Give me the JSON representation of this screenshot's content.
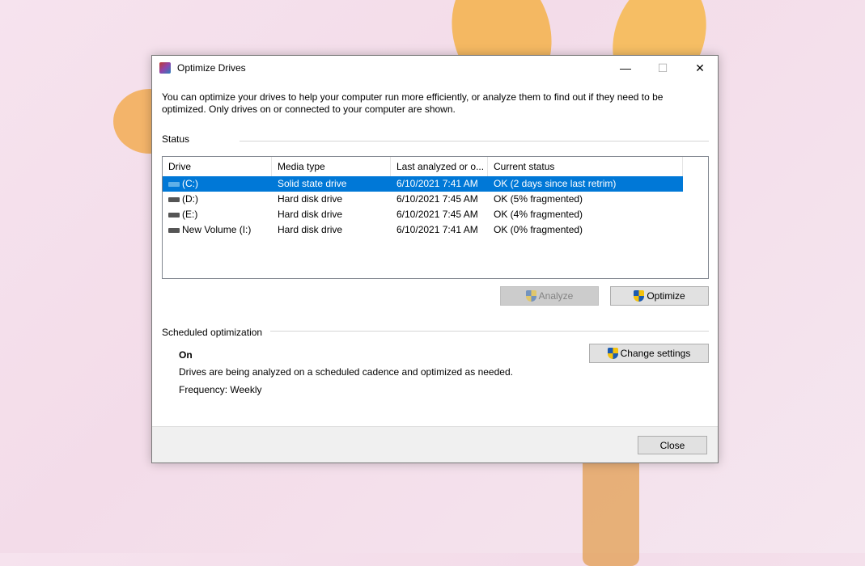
{
  "window": {
    "title": "Optimize Drives",
    "minimize": "—",
    "maximize": "☐",
    "close": "✕"
  },
  "description": "You can optimize your drives to help your computer run more efficiently, or analyze them to find out if they need to be optimized. Only drives on or connected to your computer are shown.",
  "status": {
    "label": "Status",
    "columns": [
      "Drive",
      "Media type",
      "Last analyzed or o...",
      "Current status"
    ],
    "rows": [
      {
        "drive": "(C:)",
        "media": "Solid state drive",
        "last": "6/10/2021 7:41 AM",
        "status": "OK (2 days since last retrim)",
        "selected": true
      },
      {
        "drive": "(D:)",
        "media": "Hard disk drive",
        "last": "6/10/2021 7:45 AM",
        "status": "OK (5% fragmented)"
      },
      {
        "drive": "(E:)",
        "media": "Hard disk drive",
        "last": "6/10/2021 7:45 AM",
        "status": "OK (4% fragmented)"
      },
      {
        "drive": "New Volume (I:)",
        "media": "Hard disk drive",
        "last": "6/10/2021 7:41 AM",
        "status": "OK (0% fragmented)"
      }
    ]
  },
  "buttons": {
    "analyze": "Analyze",
    "optimize": "Optimize",
    "change_settings": "Change settings",
    "close": "Close"
  },
  "scheduled": {
    "label": "Scheduled optimization",
    "state": "On",
    "info": "Drives are being analyzed on a scheduled cadence and optimized as needed.",
    "frequency": "Frequency: Weekly"
  }
}
